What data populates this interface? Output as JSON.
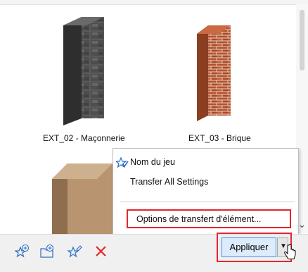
{
  "gallery": {
    "items": [
      {
        "caption": "EXT_02 - Maçonnerie",
        "texture": "stone-block"
      },
      {
        "caption": "EXT_03 - Brique",
        "texture": "brick"
      },
      {
        "caption": "",
        "texture": "wood-panel"
      }
    ]
  },
  "context_menu": {
    "items": [
      {
        "label": "Nom du jeu",
        "icon": "star-check-icon"
      },
      {
        "label": "Transfer All Settings"
      },
      {
        "label": "Options de transfert d'élément...",
        "highlighted": true
      }
    ]
  },
  "toolbar": {
    "icons": [
      "star-add-icon",
      "folder-add-icon",
      "star-edit-icon",
      "delete-icon"
    ],
    "apply_label": "Appliquer",
    "dropdown_icon": "chevron-down-icon"
  },
  "colors": {
    "highlight_outline": "#e3262e",
    "apply_button_bg": "#dcecfc",
    "apply_button_border": "#4a8ed8",
    "delete_icon": "#e3262e",
    "icon_blue": "#2d6fc4"
  }
}
